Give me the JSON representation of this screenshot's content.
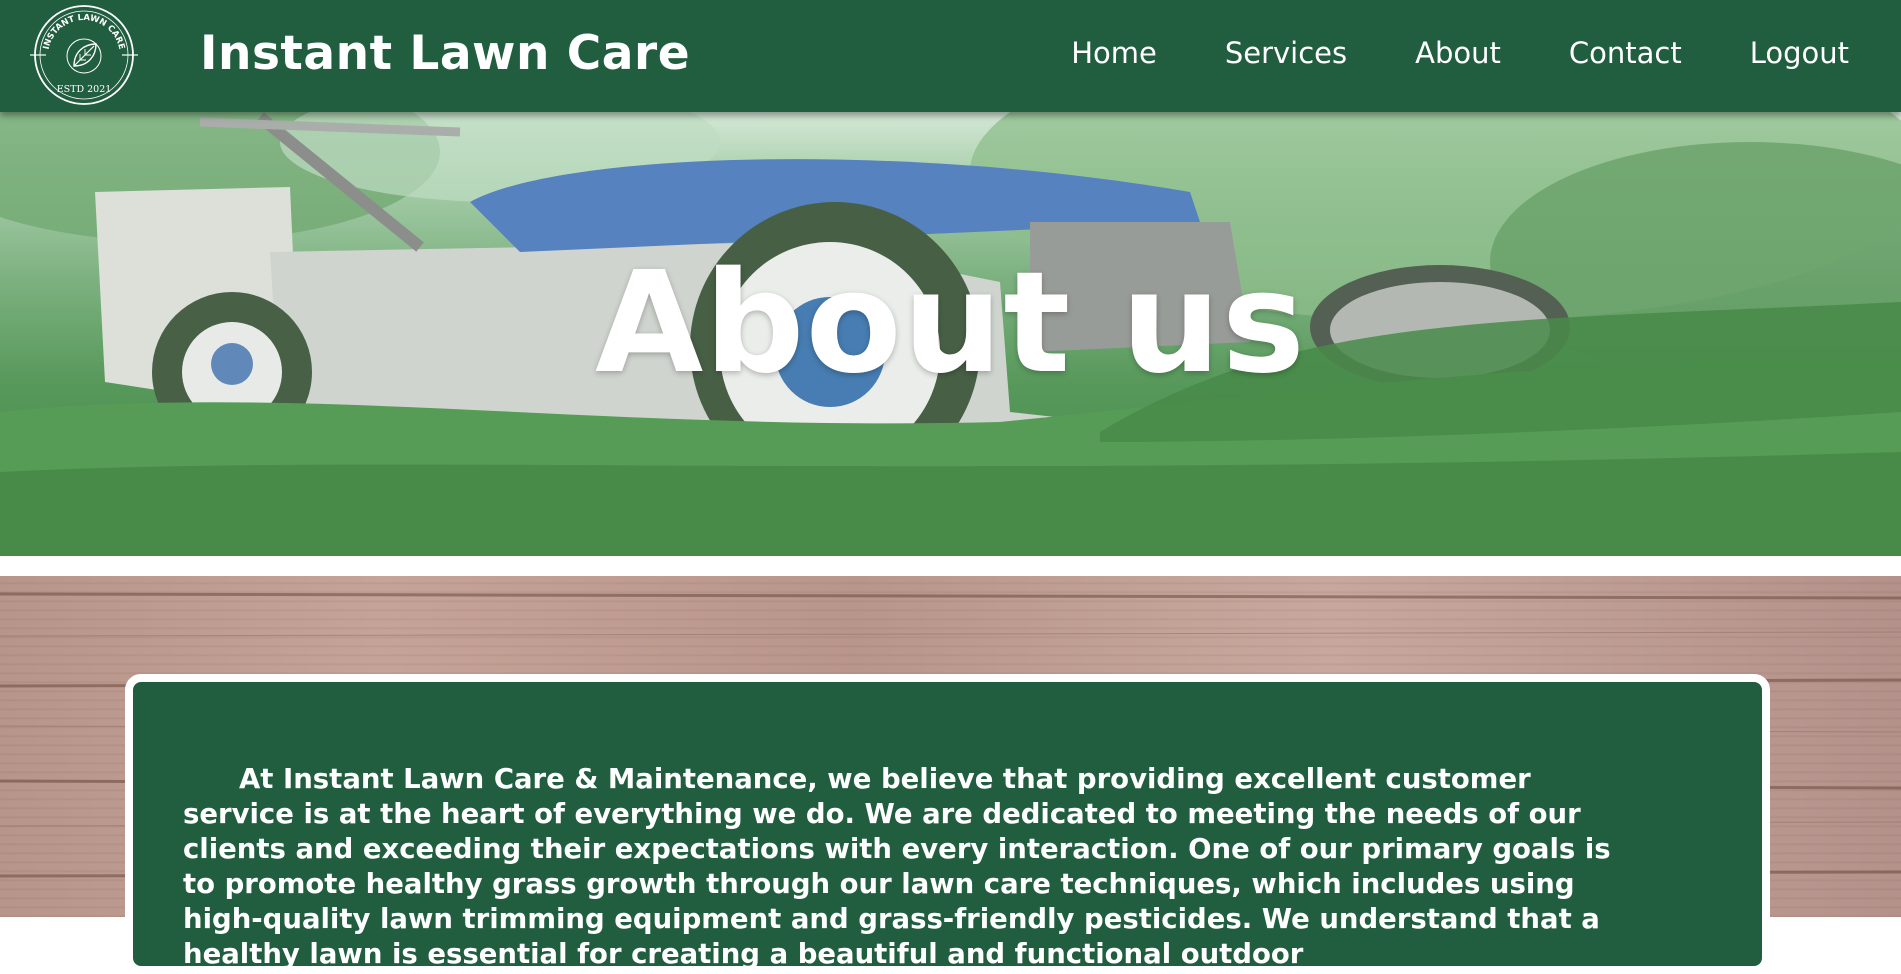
{
  "header": {
    "logo": {
      "arc_text": "INSTANT LAWN CARE",
      "bottom_text": "ESTD 2021",
      "icon": "leaf-icon"
    },
    "title": "Instant Lawn Care",
    "nav": [
      {
        "label": "Home"
      },
      {
        "label": "Services"
      },
      {
        "label": "About"
      },
      {
        "label": "Contact"
      },
      {
        "label": "Logout"
      }
    ]
  },
  "hero": {
    "title": "About us",
    "image": "lawn-mower-on-grass"
  },
  "about": {
    "paragraph": "At Instant Lawn Care & Maintenance, we believe that providing excellent customer service is at the heart of everything we do. We are dedicated to meeting the needs of our clients and exceeding their expectations with every interaction. One of our primary goals is to promote healthy grass growth through our lawn care techniques, which includes using high-quality lawn trimming equipment and grass-friendly pesticides. We understand that a healthy lawn is essential for creating a beautiful and functional outdoor"
  },
  "colors": {
    "brand_green": "#215e40",
    "text": "#ffffff"
  }
}
